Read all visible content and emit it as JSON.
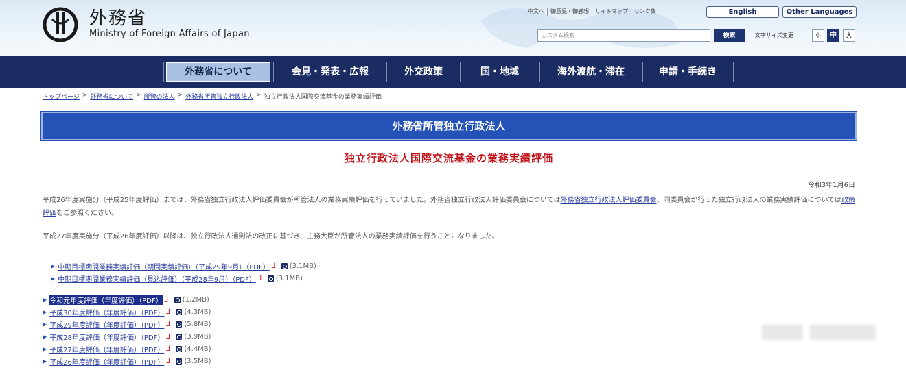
{
  "header": {
    "logo_jp": "外務省",
    "logo_en": "Ministry of Foreign Affairs of Japan",
    "top_links": [
      "中文へ",
      "御意見・御感想",
      "サイトマップ",
      "リンク集"
    ],
    "english_label": "English",
    "other_languages_label": "Other Languages",
    "search_placeholder": "カスタム検索",
    "search_button": "検索",
    "font_size_label": "文字サイズ変更",
    "font_small": "小",
    "font_medium": "中",
    "font_large": "大"
  },
  "nav": {
    "items": [
      "外務省について",
      "会見・発表・広報",
      "外交政策",
      "国・地域",
      "海外渡航・滞在",
      "申請・手続き"
    ],
    "active_index": 0
  },
  "breadcrumb": {
    "items": [
      "トップページ",
      "外務省について",
      "所管の法人",
      "外務省所管独立行政法人"
    ],
    "current": "独立行政法人国際交流基金の業務実績評価"
  },
  "main": {
    "title": "外務省所管独立行政法人",
    "subtitle": "独立行政法人国際交流基金の業務実績評価",
    "date": "令和3年1月6日",
    "para1_a": "平成26年度実施分（平成25年度評価）までは、外務省独立行政法人評価委員会が所管法人の業務実績評価を行っていました。外務省独立行政法人評価委員会については",
    "para1_link": "外務省独立行政法人評価委員会",
    "para1_b": "、同委員会が行った独立行政法人の業務実績評価については",
    "para1_link2": "政策評価",
    "para1_c": "をご参照ください。",
    "para2": "平成27年度実施分（平成26年度評価）以降は、独立行政法人通則法の改正に基づき、主務大臣が所管法人の業務実績評価を行うことになりました。"
  },
  "list1": [
    {
      "label": "中期目標期間業務実績評価（期間実績評価）（平成29年9月）（PDF）",
      "size": "(3.1MB)"
    },
    {
      "label": "中期目標期間業務実績評価（見込評価）（平成28年9月）（PDF）",
      "size": "(3.1MB)"
    }
  ],
  "list2": [
    {
      "label": "令和元年度評価（年度評価）（PDF）",
      "size": "(1.2MB)",
      "selected": true
    },
    {
      "label": "平成30年度評価（年度評価）（PDF）",
      "size": "(4.3MB)"
    },
    {
      "label": "平成29年度評価（年度評価）（PDF）",
      "size": "(5.8MB)"
    },
    {
      "label": "平成28年度評価（年度評価）（PDF）",
      "size": "(3.9MB)"
    },
    {
      "label": "平成27年度評価（年度評価）（PDF）",
      "size": "(4.4MB)"
    },
    {
      "label": "平成26年度評価（年度評価）（PDF）",
      "size": "(3.5MB)"
    }
  ],
  "colors": {
    "nav_bg": "#1b2c63",
    "title_bar": "#2452b7",
    "subtitle_red": "#c0161d",
    "link_blue": "#2b3f9e"
  },
  "icons": {
    "pdf": "pdf-icon",
    "external": "external-window-icon"
  }
}
